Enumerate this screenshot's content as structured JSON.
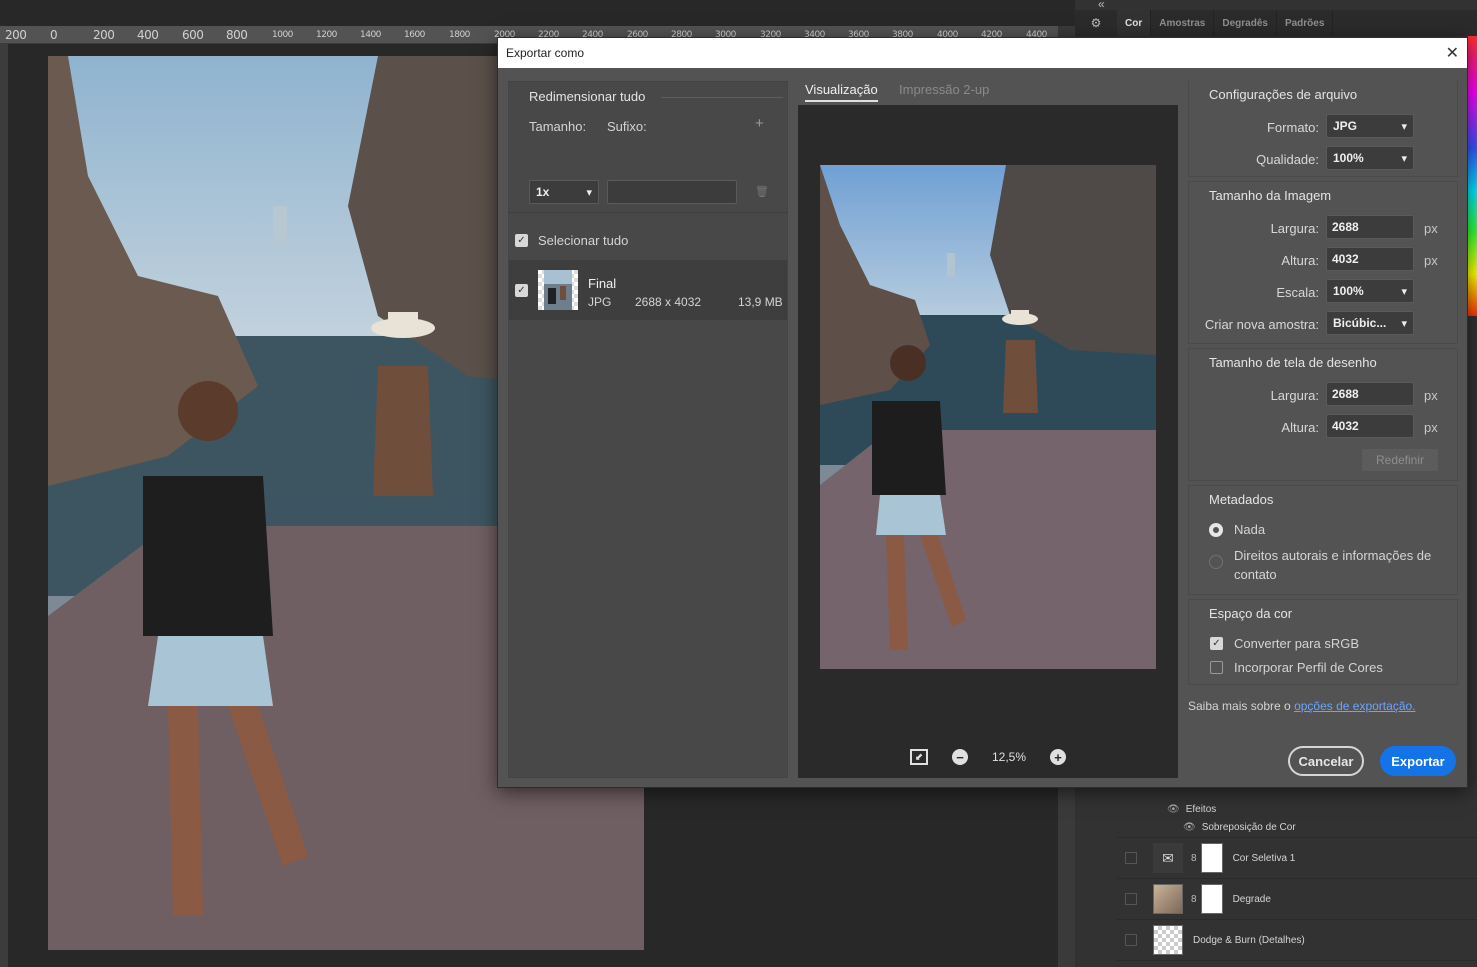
{
  "ruler": {
    "labels": [
      "200",
      "0",
      "200",
      "400",
      "600",
      "800",
      "1000",
      "1200",
      "1400",
      "1600",
      "1800",
      "2000",
      "2200",
      "2400",
      "2600",
      "2800",
      "3000",
      "3200",
      "3400",
      "3600",
      "3800",
      "4000",
      "4200",
      "4400"
    ]
  },
  "right_panel": {
    "collapse": "«",
    "tabs": [
      "Cor",
      "Amostras",
      "Degradês",
      "Padrões"
    ],
    "layers": {
      "effects_label": "Efeitos",
      "effect_item": "Sobreposição de Cor",
      "rows": [
        {
          "name": "Cor Seletiva 1"
        },
        {
          "name": "Degrade"
        },
        {
          "name": "Dodge & Burn (Detalhes)"
        }
      ]
    }
  },
  "dialog": {
    "title": "Exportar como",
    "close": "✕",
    "resize": {
      "title": "Redimensionar tudo",
      "size_label": "Tamanho:",
      "suffix_label": "Sufixo:",
      "size_value": "1x",
      "suffix_value": "",
      "add": "+",
      "remove": "🗑"
    },
    "select_all": "Selecionar tudo",
    "asset": {
      "name": "Final",
      "format": "JPG",
      "dimensions": "2688 x 4032",
      "size": "13,9 MB"
    },
    "preview": {
      "tab_active": "Visualização",
      "tab_inactive": "Impressão 2-up",
      "zoom": "12,5%",
      "zoom_out": "−",
      "zoom_in": "+"
    },
    "file_settings": {
      "title": "Configurações de arquivo",
      "format_label": "Formato:",
      "format_value": "JPG",
      "quality_label": "Qualidade:",
      "quality_value": "100%"
    },
    "image_size": {
      "title": "Tamanho da Imagem",
      "width_label": "Largura:",
      "width_value": "2688",
      "height_label": "Altura:",
      "height_value": "4032",
      "scale_label": "Escala:",
      "scale_value": "100%",
      "resample_label": "Criar nova amostra:",
      "resample_value": "Bicúbic...",
      "unit": "px"
    },
    "canvas_size": {
      "title": "Tamanho de tela de desenho",
      "width_label": "Largura:",
      "width_value": "2688",
      "height_label": "Altura:",
      "height_value": "4032",
      "unit": "px",
      "reset": "Redefinir"
    },
    "metadata": {
      "title": "Metadados",
      "option_none": "Nada",
      "option_copyright": "Direitos autorais e informações de contato"
    },
    "color_space": {
      "title": "Espaço da cor",
      "convert_srgb": "Converter para sRGB",
      "embed_profile": "Incorporar Perfil de Cores"
    },
    "learn_more_prefix": "Saiba mais sobre o",
    "learn_more_link": "opções de exportação.",
    "cancel": "Cancelar",
    "export": "Exportar"
  },
  "colors": {
    "accent": "#1473e6",
    "link": "#6aa4ff",
    "dialog_bg": "#535353"
  }
}
